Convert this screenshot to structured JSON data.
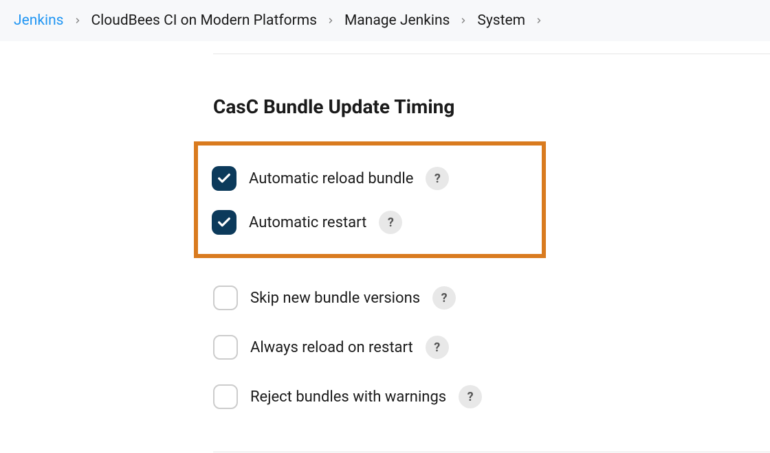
{
  "breadcrumb": {
    "items": [
      {
        "label": "Jenkins"
      },
      {
        "label": "CloudBees CI on Modern Platforms"
      },
      {
        "label": "Manage Jenkins"
      },
      {
        "label": "System"
      }
    ]
  },
  "section": {
    "title": "CasC Bundle Update Timing",
    "help_glyph": "?",
    "options": [
      {
        "label": "Automatic reload bundle",
        "checked": true,
        "highlighted": true
      },
      {
        "label": "Automatic restart",
        "checked": true,
        "highlighted": true
      },
      {
        "label": "Skip new bundle versions",
        "checked": false,
        "highlighted": false
      },
      {
        "label": "Always reload on restart",
        "checked": false,
        "highlighted": false
      },
      {
        "label": "Reject bundles with warnings",
        "checked": false,
        "highlighted": false
      }
    ]
  },
  "colors": {
    "accent_link": "#2196f3",
    "checkbox_checked_bg": "#0c3a5b",
    "highlight_border": "#d97b1f"
  }
}
